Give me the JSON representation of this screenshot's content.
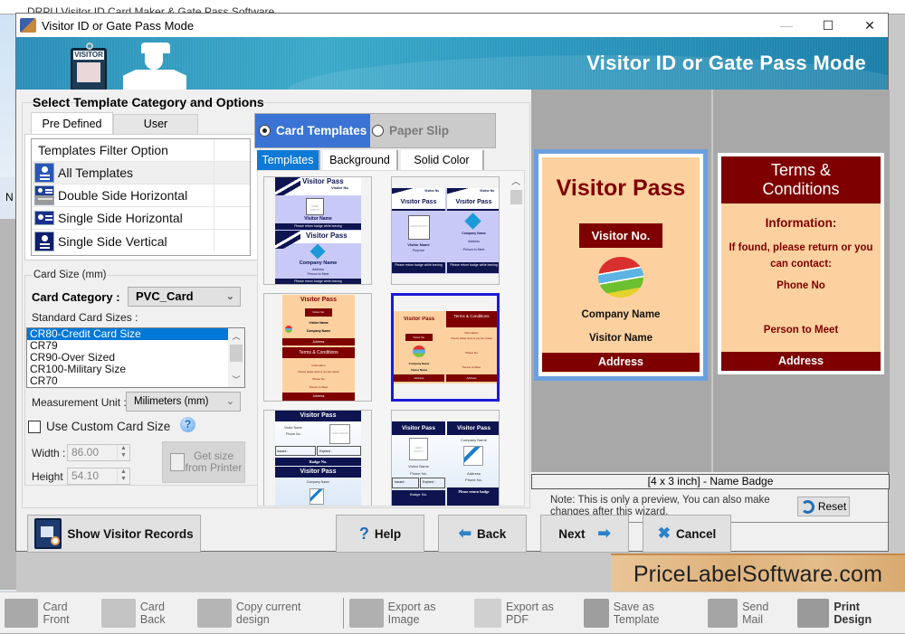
{
  "background_app": {
    "title": "DRPU Visitor ID Card Maker & Gate Pass Software",
    "left_label": "N"
  },
  "window": {
    "title": "Visitor ID or Gate Pass Mode",
    "controls": {
      "minimize": "—",
      "maximize": "☐",
      "close": "✕"
    }
  },
  "banner": {
    "title": "Visitor ID or Gate Pass Mode",
    "badge_label": "VISITOR"
  },
  "left_panel": {
    "group_title": "Select Template Category and Options",
    "tabs": [
      {
        "label": "Pre Defined",
        "active": true
      },
      {
        "label": "User Defined",
        "active": false
      }
    ],
    "filter": {
      "header": "Templates Filter Option",
      "items": [
        {
          "label": "All Templates",
          "icon": "all-templates-icon",
          "selected": true
        },
        {
          "label": "Double Side Horizontal",
          "icon": "double-side-horizontal-icon",
          "selected": false
        },
        {
          "label": "Single Side Horizontal",
          "icon": "single-side-horizontal-icon",
          "selected": false
        },
        {
          "label": "Single Side Vertical",
          "icon": "single-side-vertical-icon",
          "selected": false
        }
      ]
    },
    "card_size": {
      "legend": "Card Size (mm)",
      "category_label": "Card Category :",
      "category_value": "PVC_Card",
      "standard_sizes_label": "Standard Card Sizes :",
      "standard_sizes": [
        {
          "label": "CR80-Credit Card Size",
          "selected": true
        },
        {
          "label": "CR79",
          "selected": false
        },
        {
          "label": "CR90-Over Sized",
          "selected": false
        },
        {
          "label": "CR100-Military Size",
          "selected": false
        },
        {
          "label": "CR70",
          "selected": false
        }
      ],
      "measurement_label": "Measurement Unit :",
      "measurement_value": "Milimeters (mm)",
      "custom_size_label": "Use Custom Card Size",
      "custom_size_checked": false,
      "help_glyph": "?",
      "width_label": "Width :",
      "width_value": "86.00",
      "height_label": "Height :",
      "height_value": "54.10",
      "get_size_label": "Get size from Printer"
    }
  },
  "template_panel": {
    "mode_options": [
      {
        "label": "Card Templates",
        "selected": true
      },
      {
        "label": "Paper Slip",
        "selected": false
      }
    ],
    "subtabs": [
      {
        "label": "Templates",
        "active": true
      },
      {
        "label": "Background",
        "active": false
      },
      {
        "label": "Solid Color",
        "active": false
      }
    ],
    "thumbnails": [
      {
        "id": "t1",
        "style": "navy-lavender-double-vertical",
        "selected": false,
        "texts": {
          "title": "Visitor Pass",
          "visitor_no": "Visitor No",
          "photo": "USER PHOTO",
          "name": "Visitor Name",
          "footer": "Please return badge while leaving",
          "company": "Company Name",
          "address": "Address",
          "person": "Person to Meet"
        }
      },
      {
        "id": "t2",
        "style": "navy-lavender-double-horizontal",
        "selected": false,
        "texts": {
          "title": "Visitor Pass",
          "visitor_no": "Visitor No",
          "photo": "USER PHOTO",
          "name": "Visitor Name",
          "purpose": "Purpose",
          "company": "Company Name",
          "address": "Address",
          "person": "Person to Meet",
          "footer": "Please return badge while leaving"
        }
      },
      {
        "id": "t3",
        "style": "peach-maroon-stacked",
        "selected": false,
        "texts": {
          "title": "Visitor Pass",
          "visitor_no": "Visitor No.",
          "name": "Visitor Name",
          "company": "Company Name",
          "address": "Address",
          "terms": "Terms & Conditions",
          "info": "Information",
          "found": "If found, please return or you can contact",
          "phone": "Phone No",
          "person": "Person to Meet"
        }
      },
      {
        "id": "t4",
        "style": "peach-maroon-side-by-side",
        "selected": true,
        "texts": {
          "title": "Visitor Pass",
          "visitor_no": "Visitor No.",
          "company": "Company Name",
          "name": "Visitor Name",
          "address": "Address",
          "terms": "Terms & Conditions",
          "info": "Information:",
          "found": "If found, please return or you can contact",
          "phone": "Phone No",
          "person": "Person to Meet"
        }
      },
      {
        "id": "t5",
        "style": "navy-sky-stacked",
        "selected": false,
        "texts": {
          "title": "Visitor Pass",
          "name": "Visitor Name",
          "phone": "Phone No.",
          "photo": "USER PHOTO",
          "issued": "Issued :",
          "expired": "Expired :",
          "badge": "Badge No.",
          "company": "Company Name"
        }
      },
      {
        "id": "t6",
        "style": "navy-sky-side-by-side",
        "selected": false,
        "texts": {
          "title": "Visitor Pass",
          "photo": "USER PHOTO",
          "name": "Visitor Name",
          "phone": "Phone No.",
          "issued": "Issued :",
          "expired": "Expired :",
          "company": "Company Name",
          "address": "Address",
          "footer": "Please return badge",
          "badge": "Badge No."
        }
      }
    ]
  },
  "preview": {
    "front": {
      "title": "Visitor Pass",
      "visitor_no": "Visitor No.",
      "company": "Company Name",
      "visitor_name": "Visitor Name",
      "address": "Address"
    },
    "back": {
      "title": "Terms & Conditions",
      "info": "Information:",
      "found": "If found, please return or you can contact:",
      "phone": "Phone No",
      "person": "Person to Meet",
      "address": "Address"
    },
    "caption": "[4 x 3 inch] - Name Badge",
    "note": "Note: This is only a preview, You can also make changes after this wizard.",
    "reset_label": "Reset"
  },
  "buttons": {
    "show_records": "Show Visitor Records",
    "help": "Help",
    "back": "Back",
    "next": "Next",
    "cancel": "Cancel"
  },
  "watermark": "PriceLabelSoftware.com",
  "bottom_toolbar": [
    {
      "label": "Card Front",
      "icon": "card-front-icon"
    },
    {
      "label": "Card Back",
      "icon": "card-back-icon"
    },
    {
      "label": "Copy current design",
      "icon": "copy-design-icon"
    },
    {
      "label": "Export as Image",
      "icon": "export-image-icon"
    },
    {
      "label": "Export as PDF",
      "icon": "export-pdf-icon"
    },
    {
      "label": "Save as Template",
      "icon": "save-template-icon"
    },
    {
      "label": "Send Mail",
      "icon": "send-mail-icon"
    },
    {
      "label": "Print Design",
      "icon": "print-icon"
    }
  ],
  "colors": {
    "accent_blue": "#3a73d4",
    "tab_blue": "#0f7ad6",
    "maroon": "#7e0000",
    "peach": "#fdd19f",
    "navy": "#0d1450",
    "selection_blue": "#0078d7"
  }
}
